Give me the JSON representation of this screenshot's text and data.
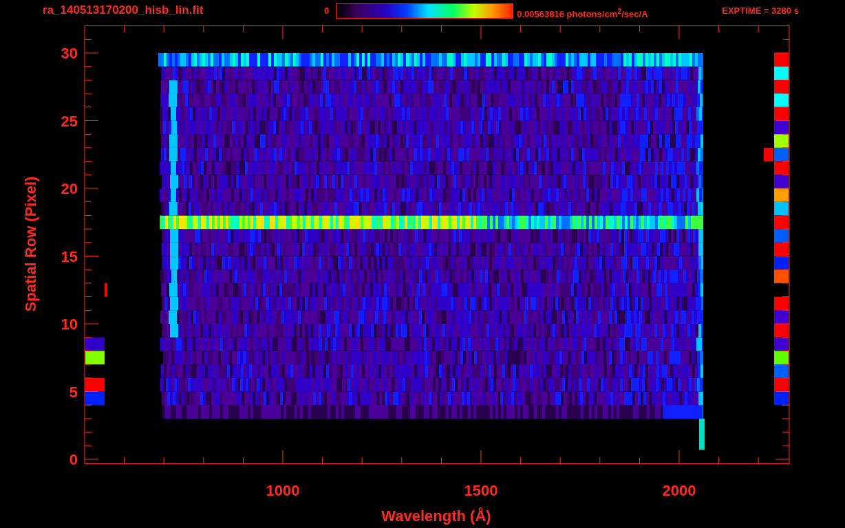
{
  "title": "ra_140513170200_hisb_lin.fit",
  "colorbar": {
    "min_label": "0",
    "max_label": "0.00563816 photons/cm$^{2}$/sec/A"
  },
  "exposure": "EXPTIME = 3280 s",
  "plot": {
    "y_axis": {
      "label": "Spatial Row (Pixel)",
      "ticks": [
        "30",
        "25",
        "20",
        "15",
        "10",
        "5",
        "0"
      ]
    },
    "x_axis": {
      "label": "Wavelength (Å)",
      "ticks": [
        "1000",
        "1500",
        "2000"
      ]
    }
  }
}
